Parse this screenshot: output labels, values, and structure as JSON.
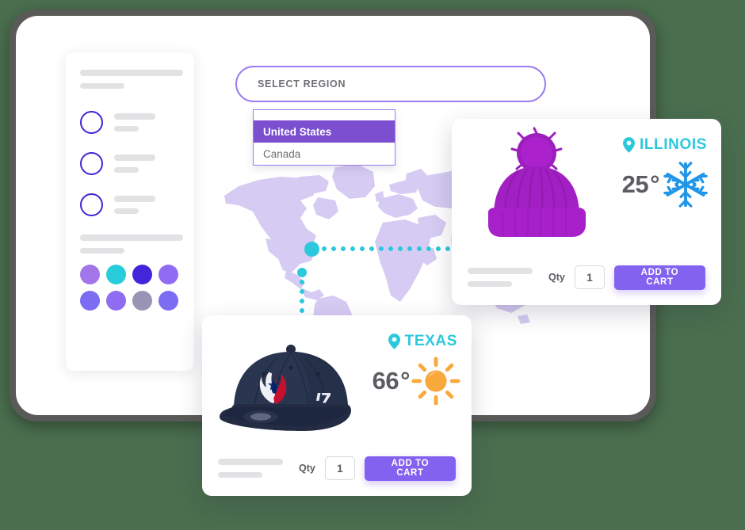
{
  "background_color": "#4a6e4e",
  "theme": {
    "accent_purple": "#8362ef",
    "accent_cyan": "#2bc8de",
    "select_border": "#9b7bf0",
    "dropdown_selected_bg": "#7b4fd0",
    "snowflake_blue": "#2196e8",
    "sun_orange": "#f9a83c",
    "skeleton_gray": "#e2e2e5",
    "frame_gray": "#5a5a58"
  },
  "select_region": {
    "label": "SELECT REGION",
    "placeholder": "SELECT REGION",
    "dropdown_options": [
      {
        "label": "",
        "selected": false
      },
      {
        "label": "United States",
        "selected": true
      },
      {
        "label": "Canada",
        "selected": false
      }
    ]
  },
  "sidebar": {
    "rows": [
      {
        "icon": "circle-outline-icon"
      },
      {
        "icon": "circle-outline-icon"
      },
      {
        "icon": "circle-outline-icon"
      }
    ],
    "swatches": [
      "#a276e8",
      "#27cddb",
      "#4226d9",
      "#8f6cf2",
      "#7b6cf2",
      "#8f6cf2",
      "#9a93b5",
      "#7b6cf2"
    ]
  },
  "map": {
    "dots": [
      {
        "name": "illinois-dot",
        "label": "Illinois"
      },
      {
        "name": "texas-dot",
        "label": "Texas"
      }
    ]
  },
  "cards": [
    {
      "id": "illinois",
      "location": "ILLINOIS",
      "temperature": "25",
      "degree_symbol": "°",
      "weather_icon": "snowflake-icon",
      "product_icon": "purple-beanie-hat",
      "qty_label": "Qty",
      "qty_value": "1",
      "add_to_cart_label": "ADD TO CART"
    },
    {
      "id": "texas",
      "location": "TEXAS",
      "temperature": "66",
      "degree_symbol": "°",
      "weather_icon": "sun-icon",
      "product_icon": "navy-baseball-cap",
      "qty_label": "Qty",
      "qty_value": "1",
      "add_to_cart_label": "ADD TO CART"
    }
  ]
}
